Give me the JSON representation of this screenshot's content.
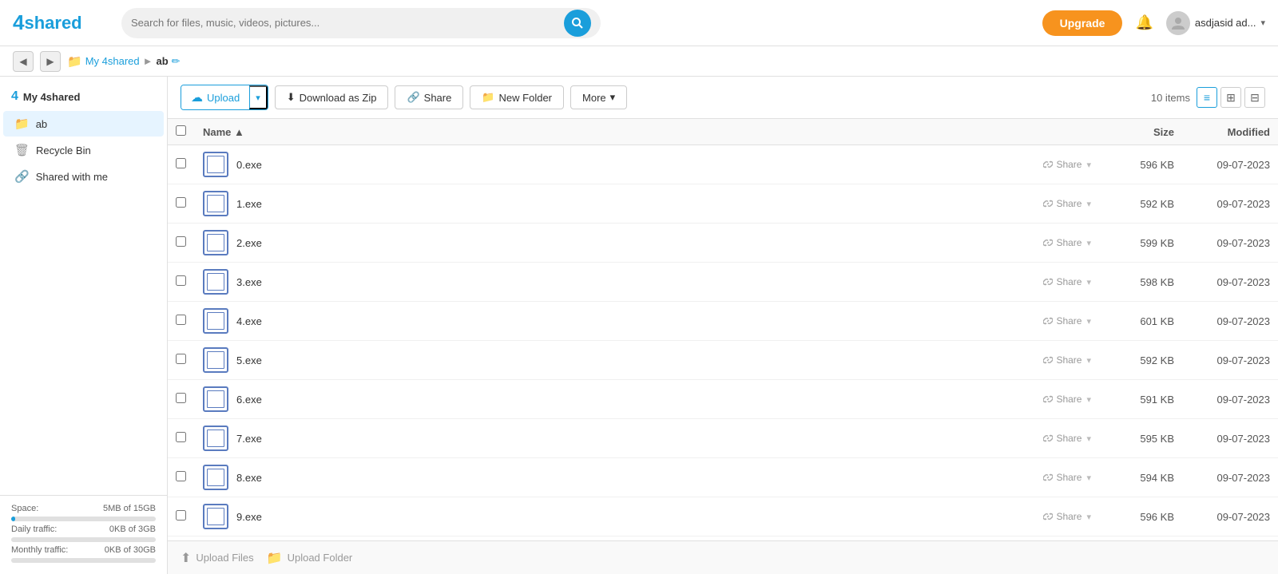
{
  "header": {
    "logo_number": "4",
    "logo_text": "shared",
    "search_placeholder": "Search for files, music, videos, pictures...",
    "upgrade_label": "Upgrade",
    "user_name": "asdjasid ad...",
    "user_dropdown": "▾"
  },
  "breadcrumb": {
    "back_icon": "◀",
    "forward_icon": "▶",
    "folder_icon": "📁",
    "root_link": "My 4shared",
    "separator": "►",
    "current": "ab",
    "edit_icon": "✏"
  },
  "sidebar": {
    "header_num": "4",
    "header_label": "My 4shared",
    "items": [
      {
        "id": "ab",
        "icon": "🔵",
        "label": "ab",
        "active": true
      },
      {
        "id": "recycle",
        "icon": "🗑",
        "label": "Recycle Bin",
        "active": false
      },
      {
        "id": "shared",
        "icon": "🔗",
        "label": "Shared with me",
        "active": false
      }
    ],
    "space_label": "Space:",
    "space_value": "5MB of 15GB",
    "space_percent": 0.03,
    "daily_label": "Daily traffic:",
    "daily_value": "0KB of 3GB",
    "daily_percent": 0,
    "monthly_label": "Monthly traffic:",
    "monthly_value": "0KB of 30GB",
    "monthly_percent": 0
  },
  "toolbar": {
    "upload_label": "Upload",
    "upload_arrow": "▾",
    "download_zip_label": "Download as Zip",
    "share_label": "Share",
    "new_folder_label": "New Folder",
    "more_label": "More",
    "more_arrow": "▾",
    "item_count": "10 items",
    "view_list_icon": "≡",
    "view_grid_icon": "⊞",
    "view_detail_icon": "⊟"
  },
  "table": {
    "col_check": "",
    "col_name": "Name ▲",
    "col_size": "Size",
    "col_modified": "Modified",
    "files": [
      {
        "name": "0.exe",
        "size": "596 KB",
        "modified": "09-07-2023"
      },
      {
        "name": "1.exe",
        "size": "592 KB",
        "modified": "09-07-2023"
      },
      {
        "name": "2.exe",
        "size": "599 KB",
        "modified": "09-07-2023"
      },
      {
        "name": "3.exe",
        "size": "598 KB",
        "modified": "09-07-2023"
      },
      {
        "name": "4.exe",
        "size": "601 KB",
        "modified": "09-07-2023"
      },
      {
        "name": "5.exe",
        "size": "592 KB",
        "modified": "09-07-2023"
      },
      {
        "name": "6.exe",
        "size": "591 KB",
        "modified": "09-07-2023"
      },
      {
        "name": "7.exe",
        "size": "595 KB",
        "modified": "09-07-2023"
      },
      {
        "name": "8.exe",
        "size": "594 KB",
        "modified": "09-07-2023"
      },
      {
        "name": "9.exe",
        "size": "596 KB",
        "modified": "09-07-2023"
      }
    ],
    "share_action": "Share",
    "share_dropdown": "▾"
  },
  "upload_bar": {
    "upload_files_icon": "⬆",
    "upload_files_label": "Upload Files",
    "upload_folder_icon": "📁",
    "upload_folder_label": "Upload Folder"
  },
  "colors": {
    "brand_blue": "#1a9edb",
    "upgrade_orange": "#f7931e",
    "file_icon_blue": "#5a7bbf"
  }
}
